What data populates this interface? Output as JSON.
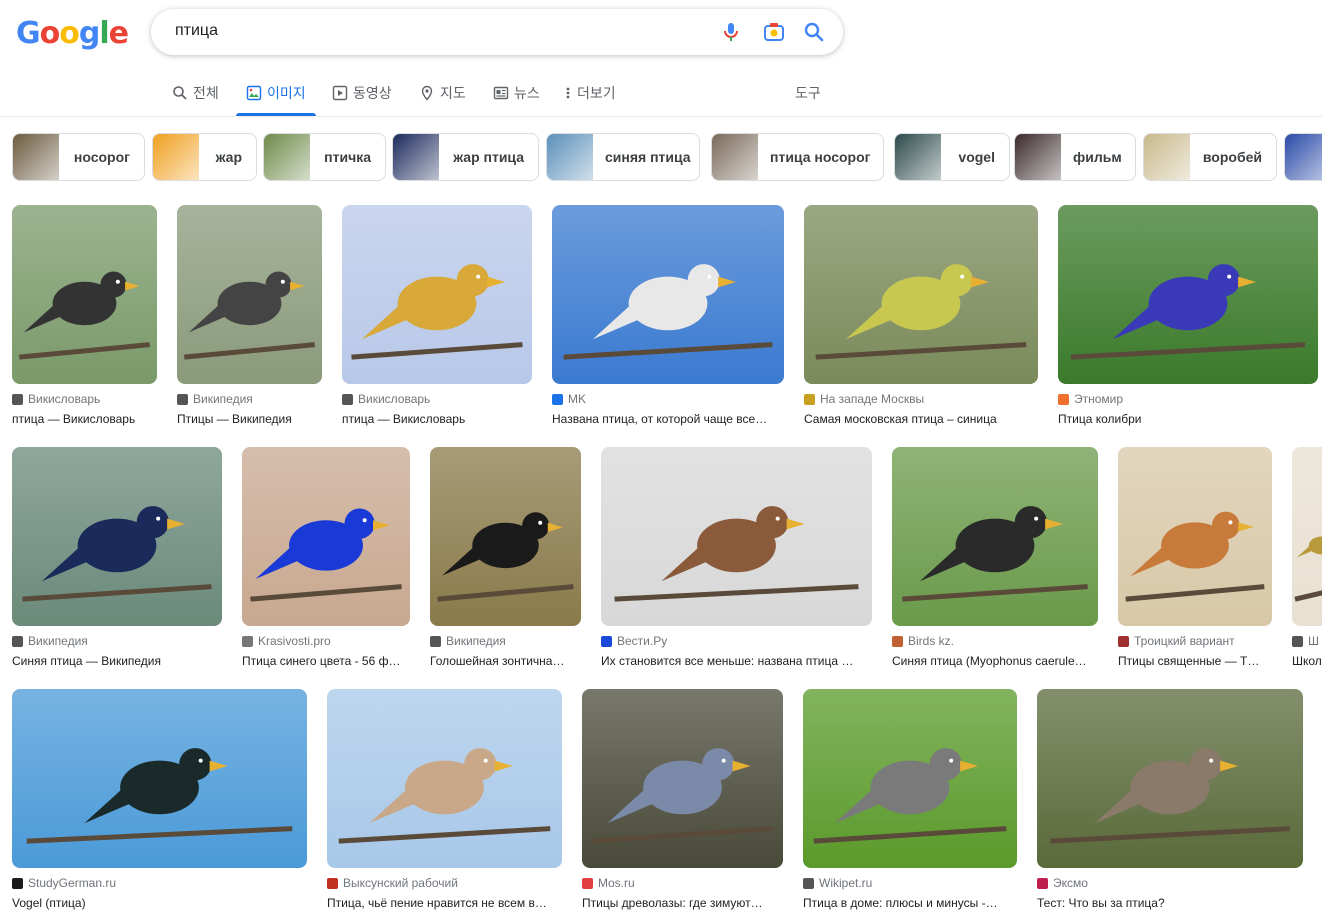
{
  "logo": {
    "letters": [
      "G",
      "o",
      "o",
      "g",
      "l",
      "e"
    ],
    "colors": [
      "#4285f4",
      "#ea4335",
      "#fbbc05",
      "#4285f4",
      "#34a853",
      "#ea4335"
    ]
  },
  "search": {
    "query": "птица"
  },
  "search_icons": [
    "mic-icon",
    "camera-icon",
    "search-icon"
  ],
  "tabs": [
    {
      "label": "전체",
      "icon": "search-icon"
    },
    {
      "label": "이미지",
      "icon": "image-icon"
    },
    {
      "label": "동영상",
      "icon": "video-icon"
    },
    {
      "label": "지도",
      "icon": "map-pin-icon"
    },
    {
      "label": "뉴스",
      "icon": "news-icon"
    },
    {
      "label": "더보기",
      "icon": "more-vert-icon"
    }
  ],
  "tools_label": "도구",
  "chips": [
    {
      "label": "носорог",
      "color": "#6b5a3e"
    },
    {
      "label": "жар",
      "color": "#f0a020"
    },
    {
      "label": "птичка",
      "color": "#6d8a4a"
    },
    {
      "label": "жар птица",
      "color": "#1c2a5c"
    },
    {
      "label": "синяя птица",
      "color": "#5b8fb9"
    },
    {
      "label": "птица носорог",
      "color": "#7a6a5a"
    },
    {
      "label": "vogel",
      "color": "#2c4a4a"
    },
    {
      "label": "фильм",
      "color": "#3a2a2a"
    },
    {
      "label": "воробей",
      "color": "#c8b88a"
    },
    {
      "label": "",
      "color": "#2a4aa8"
    }
  ],
  "results": [
    {
      "source": "Викисловарь",
      "title": "птица — Викисловарь",
      "bg": "#7a9a6a",
      "bird": "#333333"
    },
    {
      "source": "Википедия",
      "title": "Птицы — Википедия",
      "bg": "#8a9a7a",
      "bird": "#444444"
    },
    {
      "source": "Викисловарь",
      "title": "птица — Викисловарь",
      "bg": "#b8c8e8",
      "bird": "#d8a838"
    },
    {
      "source": "MK",
      "title": "Названа птица, от которой чаще все…",
      "bg": "#3a7ad0",
      "bird": "#e8e8e8"
    },
    {
      "source": "На западе Москвы",
      "title": "Самая московская птица – синица",
      "bg": "#7a8a5a",
      "bird": "#c8c850"
    },
    {
      "source": "Этномир",
      "title": "Птица колибри",
      "bg": "#3a7a2a",
      "bird": "#3a3ab8"
    },
    {
      "source": "Википедия",
      "title": "Синяя птица — Википедия",
      "bg": "#6a8a7a",
      "bird": "#1a2a5a"
    },
    {
      "source": "Krasivosti.pro",
      "title": "Птица синего цвета - 56 ф…",
      "bg": "#c8a890",
      "bird": "#1a3ad8"
    },
    {
      "source": "Википедия",
      "title": "Голошейная зонтична…",
      "bg": "#8a7a4a",
      "bird": "#1a1a1a"
    },
    {
      "source": "Вести.Ру",
      "title": "Их становится все меньше: названа птица …",
      "bg": "#d8d8d8",
      "bird": "#8a5a3a"
    },
    {
      "source": "Birds kz.",
      "title": "Синяя птица (Myophonus caerule…",
      "bg": "#6a9a4a",
      "bird": "#2a2a2a"
    },
    {
      "source": "Троицкий вариант",
      "title": "Птицы священные — Т…",
      "bg": "#d8c8a8",
      "bird": "#c87a3a"
    },
    {
      "source": "Ш",
      "title": "Школ",
      "bg": "#e8e0d0",
      "bird": "#b89a3a"
    },
    {
      "source": "StudyGerman.ru",
      "title": "Vogel (птица)",
      "bg": "#4a9ad8",
      "bird": "#1a2a2a"
    },
    {
      "source": "Выксунский рабочий",
      "title": "Птица, чьё пение нравится не всем в…",
      "bg": "#a8c8e8",
      "bird": "#c8a888"
    },
    {
      "source": "Mos.ru",
      "title": "Птицы древолазы: где зимуют…",
      "bg": "#4a4a3a",
      "bird": "#7a8aa8"
    },
    {
      "source": "Wikipet.ru",
      "title": "Птица в доме: плюсы и минусы -…",
      "bg": "#5a9a2a",
      "bird": "#7a7a7a"
    },
    {
      "source": "Эксмо",
      "title": "Тест: Что вы за птица?",
      "bg": "#5a6a3a",
      "bird": "#8a7a6a"
    }
  ]
}
